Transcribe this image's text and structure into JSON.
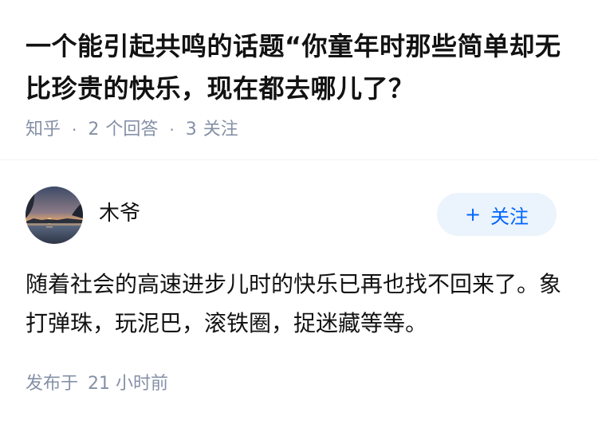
{
  "question": {
    "title": "一个能引起共鸣的话题“你童年时那些简单却无比珍贵的快乐，现在都去哪儿了？",
    "source": "知乎",
    "answers_count": "2",
    "answers_label": "个回答",
    "followers_count": "3",
    "followers_label": "关注",
    "separator": "·"
  },
  "answer": {
    "author_name": "木爷",
    "follow_label": "关注",
    "follow_icon": "+",
    "body": "随着社会的高速进步儿时的快乐已再也找不回来了。象打弹珠，玩泥巴，滚铁圈，捉迷藏等等。",
    "published_label": "发布于",
    "published_time": "21 小时前"
  },
  "colors": {
    "title": "#121212",
    "meta": "#8590a6",
    "follow_bg": "#ebf3fc",
    "follow_text": "#0066ff",
    "divider": "#f0f2f7"
  },
  "icons": {
    "follow": "plus-icon",
    "avatar": "sunset-lake-avatar"
  }
}
